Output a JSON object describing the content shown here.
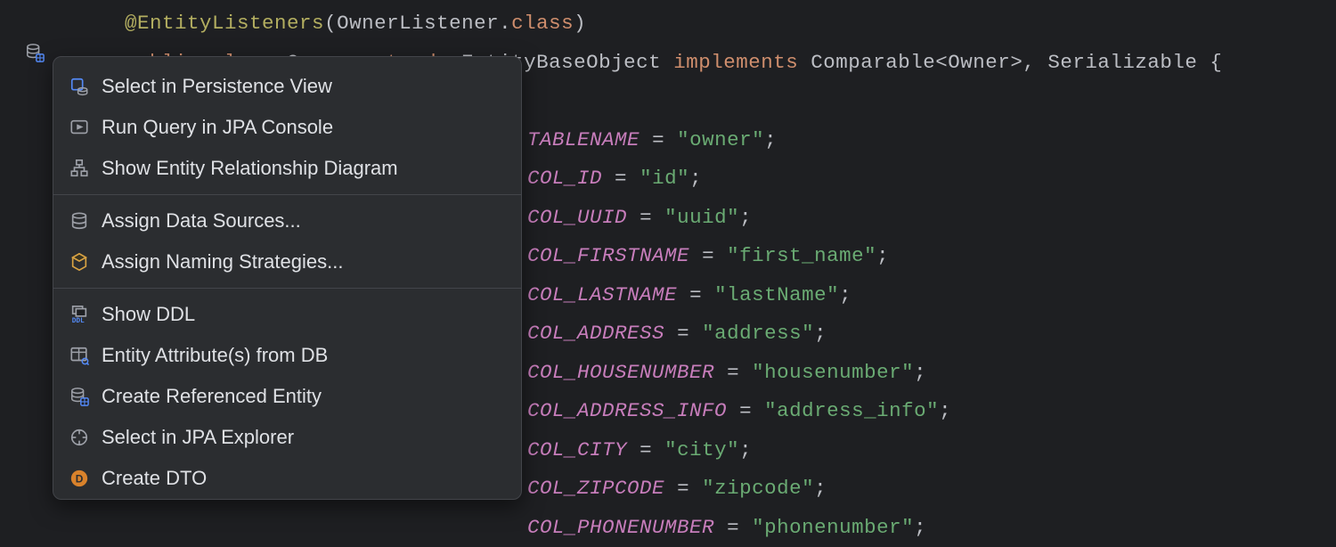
{
  "code": {
    "annotation_prefix": "@EntityListeners",
    "annotation_open": "(",
    "annotation_arg": "OwnerListener",
    "annotation_dot": ".",
    "annotation_class_kw": "class",
    "annotation_close": ")",
    "decl": {
      "public": "public",
      "class_kw": "class",
      "name": "Owner",
      "extends_kw": "extends",
      "base": "EntityBaseObject",
      "implements_kw": "implements",
      "comparable": "Comparable",
      "lt": "<",
      "gen": "Owner",
      "gt": ">",
      "comma": ",",
      "serializable": "Serializable",
      "brace": "{"
    },
    "consts": [
      {
        "name": "TABLENAME",
        "value": "\"owner\""
      },
      {
        "name": "COL_ID",
        "value": "\"id\""
      },
      {
        "name": "COL_UUID",
        "value": "\"uuid\""
      },
      {
        "name": "COL_FIRSTNAME",
        "value": "\"first_name\""
      },
      {
        "name": "COL_LASTNAME",
        "value": "\"lastName\""
      },
      {
        "name": "COL_ADDRESS",
        "value": "\"address\""
      },
      {
        "name": "COL_HOUSENUMBER",
        "value": "\"housenumber\""
      },
      {
        "name": "COL_ADDRESS_INFO",
        "value": "\"address_info\""
      },
      {
        "name": "COL_CITY",
        "value": "\"city\""
      },
      {
        "name": "COL_ZIPCODE",
        "value": "\"zipcode\""
      },
      {
        "name": "COL_PHONENUMBER",
        "value": "\"phonenumber\""
      }
    ]
  },
  "menu": {
    "items": [
      {
        "label": "Select in Persistence View",
        "icon": "persistence"
      },
      {
        "label": "Run Query in JPA Console",
        "icon": "run-console"
      },
      {
        "label": "Show Entity Relationship Diagram",
        "icon": "diagram"
      },
      {
        "sep": true
      },
      {
        "label": "Assign Data Sources...",
        "icon": "datasource"
      },
      {
        "label": "Assign Naming Strategies...",
        "icon": "naming"
      },
      {
        "sep": true
      },
      {
        "label": "Show DDL",
        "icon": "ddl"
      },
      {
        "label": "Entity Attribute(s) from DB",
        "icon": "table"
      },
      {
        "label": "Create Referenced Entity",
        "icon": "entity"
      },
      {
        "label": "Select in JPA Explorer",
        "icon": "explorer"
      },
      {
        "label": "Create DTO",
        "icon": "dto"
      }
    ]
  }
}
